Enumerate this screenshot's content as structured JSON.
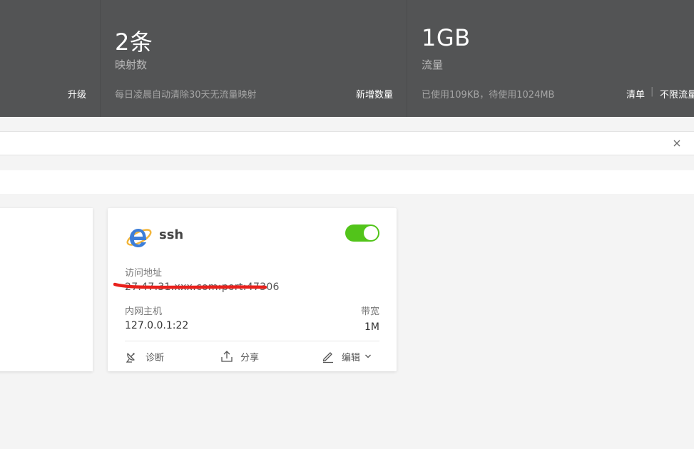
{
  "stats": {
    "col1": {
      "action": "升级"
    },
    "col2": {
      "value": "2条",
      "label": "映射数",
      "desc": "每日凌晨自动清除30天无流量映射",
      "action": "新增数量"
    },
    "col3": {
      "value": "1GB",
      "label": "流量",
      "desc": "已使用109KB，待使用1024MB",
      "action1": "清单",
      "separator": "|",
      "action2": "不限流量"
    }
  },
  "card": {
    "title": "ssh",
    "icon": "internet-explorer-icon",
    "enabled": true,
    "address_label": "访问地址",
    "address_value": "27.47.31.xxx.com:port:47306",
    "host_label": "内网主机",
    "host_value": "127.0.0.1:22",
    "bandwidth_label": "带宽",
    "bandwidth_value": "1M",
    "actions": {
      "diagnose": "诊断",
      "share": "分享",
      "edit": "编辑"
    }
  },
  "colors": {
    "header_bg": "#535455",
    "toggle_on": "#52c41a",
    "redaction": "#e8211c"
  }
}
